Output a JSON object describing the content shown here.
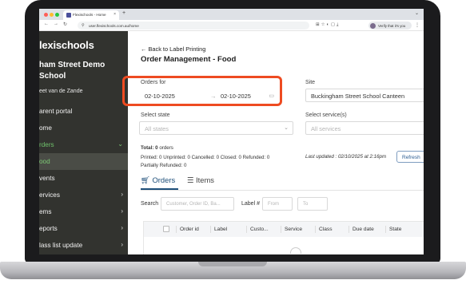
{
  "browser": {
    "tab_title": "Flexischools - Home",
    "url": "user.flexischools.com.au/home",
    "profile_label": "Verify that it's you",
    "new_tab": "+",
    "tab_close": "×"
  },
  "sidebar": {
    "brand": "lexischools",
    "school_name": "ham Street Demo School",
    "user_name": "eet van de Zande",
    "items": [
      {
        "label": "arent portal"
      },
      {
        "label": "ome"
      },
      {
        "label": "rders"
      },
      {
        "label": "ood"
      },
      {
        "label": "vents"
      },
      {
        "label": "ervices"
      },
      {
        "label": "ems"
      },
      {
        "label": "eports"
      },
      {
        "label": "lass list update"
      }
    ]
  },
  "main": {
    "back_link": "Back to Label Printing",
    "page_title": "Order Management - Food",
    "orders_for": {
      "label": "Orders for",
      "from": "02-10-2025",
      "to": "02-10-2025"
    },
    "site": {
      "label": "Site",
      "value": "Buckingham Street School Canteen"
    },
    "select_state": {
      "label": "Select state",
      "placeholder": "All states"
    },
    "select_services": {
      "label": "Select service(s)",
      "placeholder": "All services"
    },
    "summary": {
      "total_label": "Total:",
      "total_value": "0",
      "total_suffix": "orders",
      "line2": "Printed: 0 Unprinted: 0 Cancelled: 0 Closed: 0 Refunded: 0",
      "line3": "Partially Refunded: 0"
    },
    "last_updated": "Last updated : 02/10/2025 at 2:16pm",
    "refresh_label": "Refresh",
    "tabs": [
      {
        "label": "Orders"
      },
      {
        "label": "Items"
      }
    ],
    "search": {
      "label": "Search",
      "placeholder": "Customer, Order ID, Ba...",
      "label_no": "Label #",
      "from_placeholder": "From",
      "to_placeholder": "To"
    },
    "table_headers": [
      "Order id",
      "Label",
      "Custo...",
      "Service",
      "Class",
      "Due date",
      "State"
    ]
  },
  "colors": {
    "sidebar_bg": "#32332f",
    "accent_green": "#6fc06b",
    "highlight": "#ee4b21",
    "link_blue": "#1e4f7a"
  }
}
